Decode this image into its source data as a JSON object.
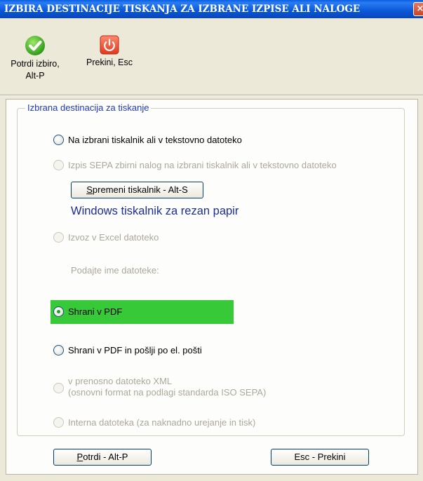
{
  "window": {
    "title": "IZBIRA DESTINACIJE TISKANJA ZA IZBRANE IZPISE ALI NALOGE",
    "close_symbol": "×"
  },
  "toolbar": {
    "confirm": {
      "icon": "check-circle-icon",
      "label_line1": "Potrdi izbiro,",
      "label_line2": "Alt-P"
    },
    "cancel": {
      "icon": "power-icon",
      "label": "Prekini, Esc"
    }
  },
  "group": {
    "legend": "Izbrana destinacija za tiskanje",
    "options": [
      {
        "label": "Na izbrani tiskalnik ali v tekstovno datoteko",
        "enabled": true,
        "checked": false
      },
      {
        "label": "Izpis SEPA zbirni nalog na izbrani tiskalnik ali v tekstovno datoteko",
        "enabled": false,
        "checked": false
      },
      {
        "label": "Izvoz v Excel datoteko",
        "enabled": false,
        "checked": false
      },
      {
        "label": "Shrani v PDF",
        "enabled": true,
        "checked": true
      },
      {
        "label": "Shrani v PDF in pošlji po el. pošti",
        "enabled": true,
        "checked": false
      },
      {
        "label_line1": "v prenosno datoteko XML",
        "label_line2": "(osnovni format na podlagi standarda ISO SEPA)",
        "enabled": false,
        "checked": false
      },
      {
        "label": "Interna datoteka (za naknadno urejanje in tisk)",
        "enabled": false,
        "checked": false
      }
    ],
    "change_printer_button": {
      "mnemonic": "S",
      "rest": "premeni tiskalnik - Alt-S"
    },
    "printer_info": "Windows tiskalnik za rezan papir",
    "filename_label": "Podajte ime datoteke:"
  },
  "buttons": {
    "confirm": {
      "mnemonic": "P",
      "rest": "otrdi - Alt-P"
    },
    "cancel": {
      "label": "Esc - Prekini"
    }
  },
  "colors": {
    "selected_highlight": "#38c938",
    "title_bar": "#0a57d8",
    "legend_text": "#1f38c8"
  }
}
